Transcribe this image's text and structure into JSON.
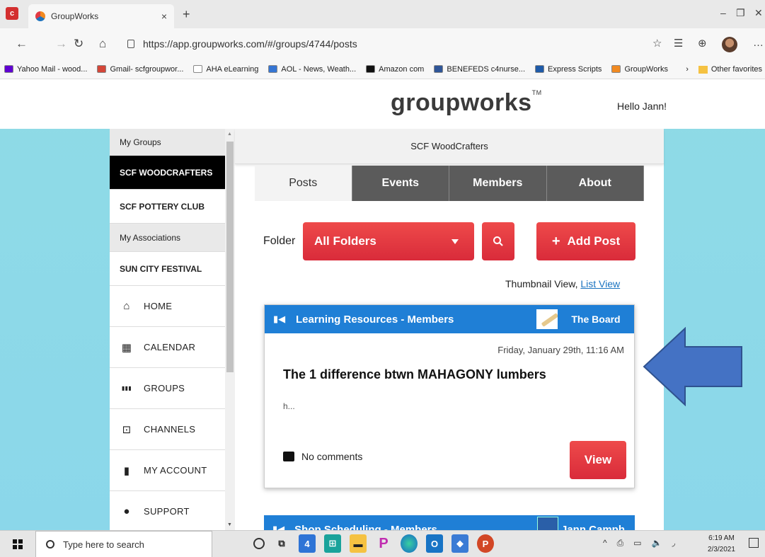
{
  "browser": {
    "tab_title": "GroupWorks",
    "tab_close": "×",
    "new_tab": "+",
    "url": "https://app.groupworks.com/#/groups/4744/posts",
    "bookmarks": [
      {
        "label": "Yahoo Mail - wood...",
        "color": "#6001d2"
      },
      {
        "label": "Gmail- scfgroupwor...",
        "color": "#d44638"
      },
      {
        "label": "AHA eLearning",
        "color": "#ffffff"
      },
      {
        "label": "AOL - News, Weath...",
        "color": "#3575d3"
      },
      {
        "label": "Amazon com",
        "color": "#111111"
      },
      {
        "label": "BENEFEDS c4nurse...",
        "color": "#2f5597"
      },
      {
        "label": "Express Scripts",
        "color": "#1e5aa8"
      },
      {
        "label": "GroupWorks",
        "color": "#f18a22"
      }
    ],
    "bookmarks_more": "Other favorites"
  },
  "site": {
    "logo": "groupworks",
    "logo_tm": "TM",
    "greeting": "Hello Jann!"
  },
  "sidebar": {
    "my_groups": "My Groups",
    "active_group": "SCF WOODCRAFTERS",
    "group2": "SCF POTTERY CLUB",
    "my_associations": "My Associations",
    "association": "SUN CITY FESTIVAL",
    "nav": [
      {
        "label": "HOME",
        "icon": "home-icon"
      },
      {
        "label": "CALENDAR",
        "icon": "calendar-icon"
      },
      {
        "label": "GROUPS",
        "icon": "groups-icon"
      },
      {
        "label": "CHANNELS",
        "icon": "channels-icon"
      },
      {
        "label": "MY ACCOUNT",
        "icon": "account-icon"
      },
      {
        "label": "SUPPORT",
        "icon": "support-icon"
      }
    ]
  },
  "main": {
    "group_name": "SCF WoodCrafters",
    "tabs": [
      "Posts",
      "Events",
      "Members",
      "About"
    ],
    "folder_label": "Folder",
    "folder_value": "All Folders",
    "add_post": "Add Post",
    "thumbnail_view": "Thumbnail View,",
    "list_view": "List View",
    "post": {
      "category": "Learning Resources - Members",
      "author": "The Board",
      "date": "Friday, January 29th, 11:16 AM",
      "title": "The 1 difference btwn MAHAGONY lumbers",
      "excerpt": "h...",
      "comments": "No comments",
      "view": "View"
    },
    "post2": {
      "category": "Shop Scheduling - Members",
      "author": "Jann Camph"
    }
  },
  "taskbar": {
    "search_placeholder": "Type here to search",
    "time": "6:19 AM",
    "date": "2/3/2021"
  },
  "colors": {
    "accent_red": "#e23a42",
    "header_blue": "#1f7fd6",
    "arrow_blue": "#4472c4",
    "page_bg": "#8fdbe6"
  }
}
